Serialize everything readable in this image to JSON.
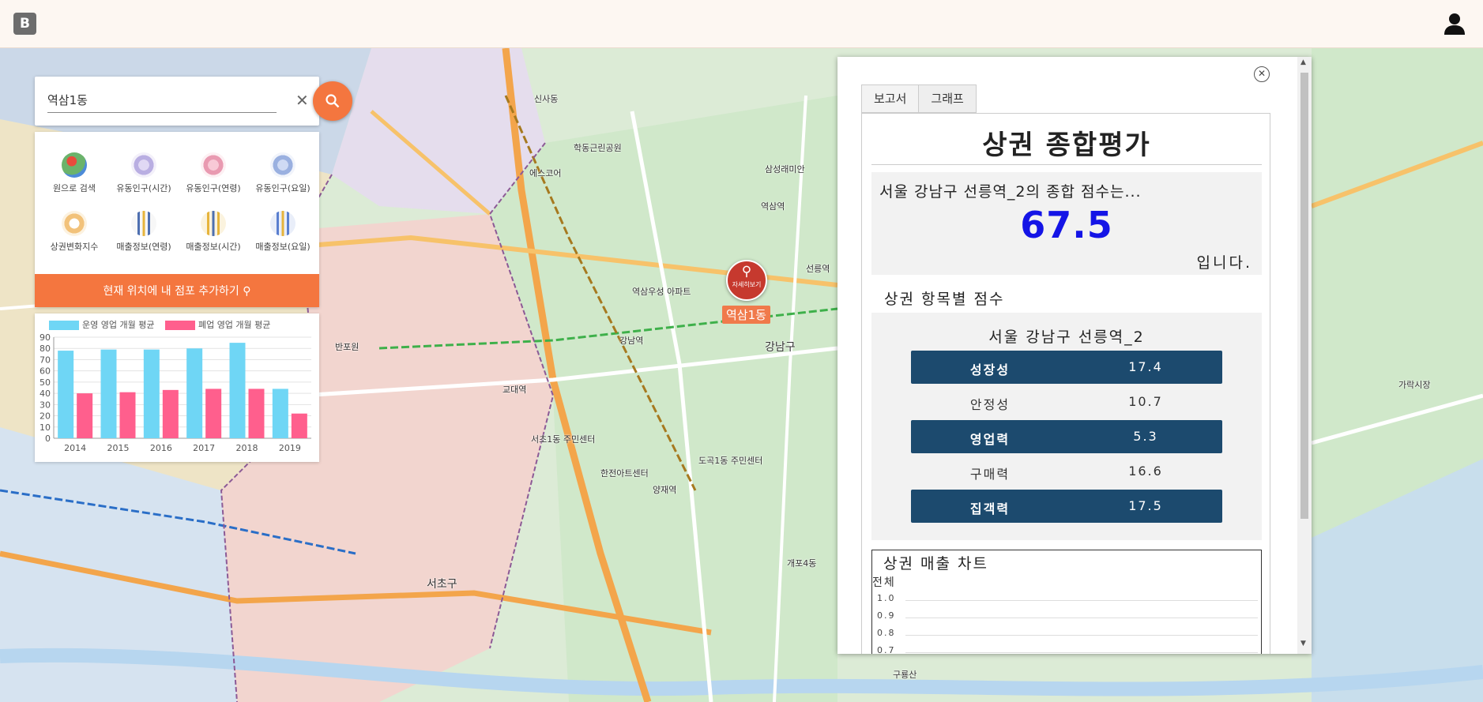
{
  "header": {
    "logo_letter": "B"
  },
  "search": {
    "value": "역삼1동"
  },
  "menu": {
    "items": [
      {
        "label": "원으로 검색",
        "icon": "map-pin-icon",
        "color": "#6bb36b"
      },
      {
        "label": "유동인구(시간)",
        "icon": "people-icon",
        "color": "#a99ad6"
      },
      {
        "label": "유동인구(연령)",
        "icon": "people-icon",
        "color": "#e99ab1"
      },
      {
        "label": "유동인구(요일)",
        "icon": "people-icon",
        "color": "#9ab0e0"
      },
      {
        "label": "상권변화지수",
        "icon": "document-icon",
        "color": "#f2c27a"
      },
      {
        "label": "매출정보(연령)",
        "icon": "bar-chart-icon",
        "color": "#4e6fb0"
      },
      {
        "label": "매출정보(시간)",
        "icon": "bar-chart-icon",
        "color": "#e6b43c"
      },
      {
        "label": "매출정보(요일)",
        "icon": "bar-chart-icon",
        "color": "#5a7fcf"
      }
    ],
    "add_store_label": "현재 위치에 내 점포 추가하기"
  },
  "chart_data": {
    "type": "bar",
    "categories": [
      "2014",
      "2015",
      "2016",
      "2017",
      "2018",
      "2019"
    ],
    "series": [
      {
        "name": "운영 영업 개월 평균",
        "color": "#6fd6f5",
        "values": [
          78,
          79,
          79,
          80,
          85,
          44
        ]
      },
      {
        "name": "폐업 영업 개월 평균",
        "color": "#ff5f8d",
        "values": [
          40,
          41,
          43,
          44,
          44,
          22
        ]
      }
    ],
    "ylim": [
      0,
      90
    ],
    "yticks": [
      "90",
      "80",
      "70",
      "60",
      "50",
      "40",
      "30",
      "20",
      "10",
      "0"
    ],
    "grid": true,
    "legend": "top"
  },
  "map": {
    "marker_label": "역삼1동",
    "marker_button": "자세히보기",
    "labels": [
      "역삼1동",
      "강남역",
      "역삼역",
      "선릉역",
      "교대역",
      "서초구",
      "강남구",
      "양재역",
      "반포원",
      "서초1동 주민센터",
      "도곡1동 주민센터",
      "역삼우성 아파트",
      "한전아트센터",
      "삼성래미안",
      "신사동",
      "학동근린공원",
      "에스코어",
      "개포4동",
      "구룡산",
      "가락시장"
    ]
  },
  "report": {
    "tabs": [
      "보고서",
      "그래프"
    ],
    "title": "상권 종합평가",
    "score_intro": "서울 강남구 선릉역_2의 종합 점수는...",
    "score": "67.5",
    "score_suffix": "입니다.",
    "items_heading": "상권 항목별 점수",
    "items_area": "서울 강남구 선릉역_2",
    "items": [
      {
        "name": "성장성",
        "value": "17.4"
      },
      {
        "name": "안정성",
        "value": "10.7"
      },
      {
        "name": "영업력",
        "value": "5.3"
      },
      {
        "name": "구매력",
        "value": "16.6"
      },
      {
        "name": "집객력",
        "value": "17.5"
      }
    ],
    "sales_title": "상권 매출 차트",
    "sales_subtitle": "전체",
    "sales_yticks": [
      "1.0",
      "0.9",
      "0.8",
      "0.7"
    ]
  }
}
